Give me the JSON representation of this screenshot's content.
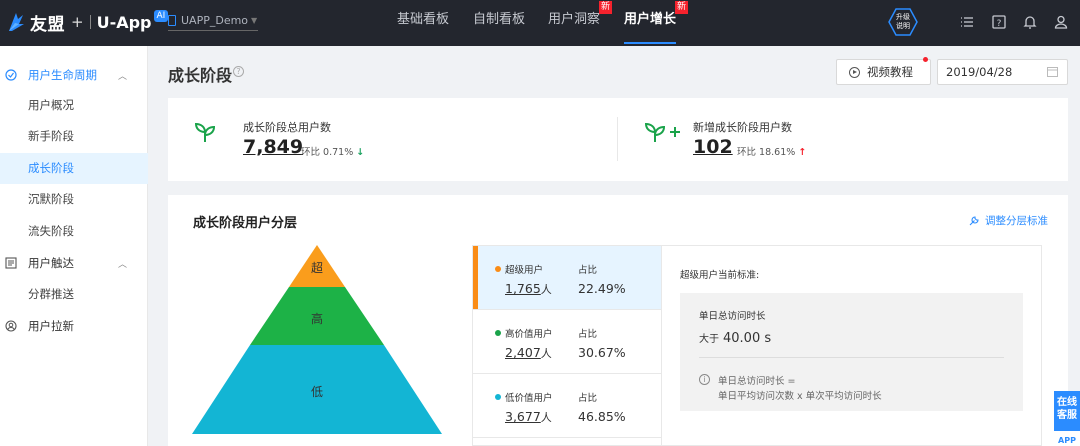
{
  "topbar": {
    "brand": "友盟",
    "brand_plus": "+",
    "product": "U-App",
    "ai_badge": "AI",
    "app_name": "UAPP_Demo",
    "nav": [
      {
        "label": "基础看板"
      },
      {
        "label": "自制看板"
      },
      {
        "label": "用户洞察",
        "badge": "新"
      },
      {
        "label": "用户增长",
        "badge": "新",
        "active": true
      }
    ],
    "upgrade_label_1": "升级",
    "upgrade_label_2": "说明"
  },
  "sidebar": {
    "groups": [
      {
        "label": "用户生命周期",
        "icon": "lifecycle-icon",
        "open": true,
        "items": [
          "用户概况",
          "新手阶段",
          "成长阶段",
          "沉默阶段",
          "流失阶段"
        ],
        "active_item": "成长阶段"
      },
      {
        "label": "用户触达",
        "icon": "reach-icon",
        "open": true,
        "items": [
          "分群推送"
        ]
      },
      {
        "label": "用户拉新",
        "icon": "acquire-icon",
        "open": false,
        "items": []
      }
    ]
  },
  "header": {
    "title": "成长阶段",
    "video_button": "视频教程",
    "date": "2019/04/28"
  },
  "kpis": [
    {
      "label": "成长阶段总用户数",
      "value": "7,849",
      "ratio_label": "环比",
      "ratio": "0.71%",
      "trend": "down"
    },
    {
      "label": "新增成长阶段用户数",
      "value": "102",
      "ratio_label": "环比",
      "ratio": "18.61%",
      "trend": "up"
    }
  ],
  "segments": {
    "title": "成长阶段用户分层",
    "adjust_link": "调整分层标准",
    "pyramid": [
      {
        "label": "超",
        "color": "#fa9d1c"
      },
      {
        "label": "高",
        "color": "#1db247"
      },
      {
        "label": "低",
        "color": "#13b5d4"
      }
    ],
    "rows": [
      {
        "name": "超级用户",
        "count": "1,765",
        "unit": "人",
        "ratio_label": "占比",
        "ratio": "22.49%",
        "dot": "#fa8c16"
      },
      {
        "name": "高价值用户",
        "count": "2,407",
        "unit": "人",
        "ratio_label": "占比",
        "ratio": "30.67%",
        "dot": "#1aa34a"
      },
      {
        "name": "低价值用户",
        "count": "3,677",
        "unit": "人",
        "ratio_label": "占比",
        "ratio": "46.85%",
        "dot": "#13b5d4"
      }
    ],
    "standard": {
      "title": "超级用户当前标准:",
      "metric": "单日总访问时长",
      "cond": "大于",
      "value": "40.00 s",
      "formula_1": "单日总访问时长 =",
      "formula_2": "单日平均访问次数 x 单次平均访问时长"
    }
  },
  "float": {
    "chat": "在线客服",
    "app": "APP"
  }
}
